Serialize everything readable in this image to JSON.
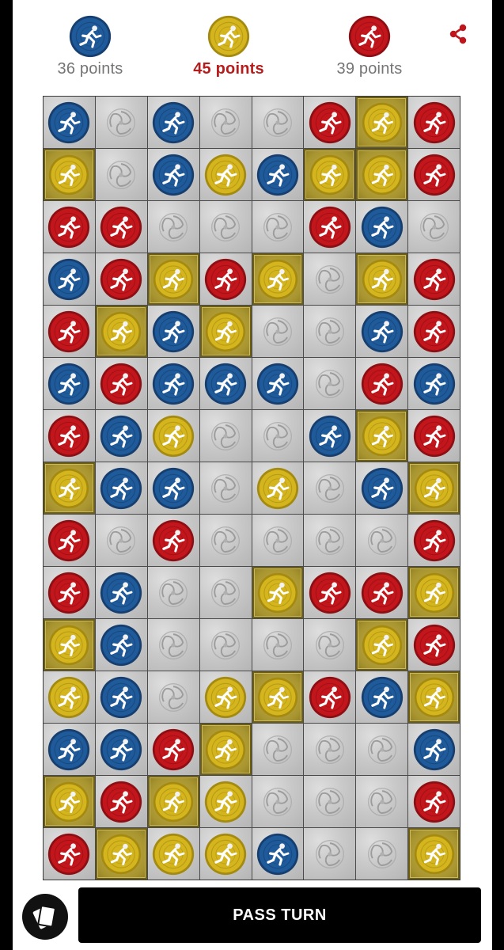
{
  "app": {
    "share_icon": "share-icon",
    "deck_icon": "cards-icon"
  },
  "colors": {
    "blue": "#1f5a9a",
    "yellow": "#d4b51e",
    "red": "#c3161c",
    "active_score": "#b71c1c",
    "inactive_score": "#757575",
    "empty_tile": "#c9c9c9",
    "owned_tile": "#a89530"
  },
  "players": [
    {
      "color": "blue",
      "score_label": "36 points",
      "active": false
    },
    {
      "color": "yellow",
      "score_label": "45 points",
      "active": true
    },
    {
      "color": "red",
      "score_label": "39 points",
      "active": false
    }
  ],
  "board": {
    "columns": 8,
    "rows": 15,
    "legend": "B = blue runner, Y = yellow runner, R = red runner, . = empty swirl tile, + = yellow claimed tile",
    "cells": [
      [
        "B",
        ".",
        "B",
        ".",
        ".",
        "R",
        "Y+",
        "R"
      ],
      [
        "Y+",
        ".",
        "B",
        "Y",
        "B",
        "Y+",
        "Y+",
        "R"
      ],
      [
        "R",
        "R",
        ".",
        ".",
        ".",
        "R",
        "B",
        "."
      ],
      [
        "B",
        "R",
        "Y+",
        "R",
        "Y+",
        ".",
        "Y+",
        "R"
      ],
      [
        "R",
        "Y+",
        "B",
        "Y+",
        ".",
        ".",
        "B",
        "R"
      ],
      [
        "B",
        "R",
        "B",
        "B",
        "B",
        ".",
        "R",
        "B"
      ],
      [
        "R",
        "B",
        "Y",
        ".",
        ".",
        "B",
        "Y+",
        "R"
      ],
      [
        "Y+",
        "B",
        "B",
        ".",
        "Y",
        ".",
        "B",
        "Y+"
      ],
      [
        "R",
        ".",
        "R",
        ".",
        ".",
        ".",
        ".",
        "R"
      ],
      [
        "R",
        "B",
        ".",
        ".",
        "Y+",
        "R",
        "R",
        "Y+"
      ],
      [
        "Y+",
        "B",
        ".",
        ".",
        ".",
        ".",
        "Y+",
        "R"
      ],
      [
        "Y",
        "B",
        ".",
        "Y",
        "Y+",
        "R",
        "B",
        "Y+"
      ],
      [
        "B",
        "B",
        "R",
        "Y+",
        ".",
        ".",
        ".",
        "B"
      ],
      [
        "Y+",
        "R",
        "Y+",
        "Y",
        ".",
        ".",
        ".",
        "R"
      ],
      [
        "R",
        "Y+",
        "Y",
        "Y",
        "B",
        ".",
        ".",
        "Y+"
      ]
    ]
  },
  "footer": {
    "pass_turn_label": "PASS TURN"
  }
}
